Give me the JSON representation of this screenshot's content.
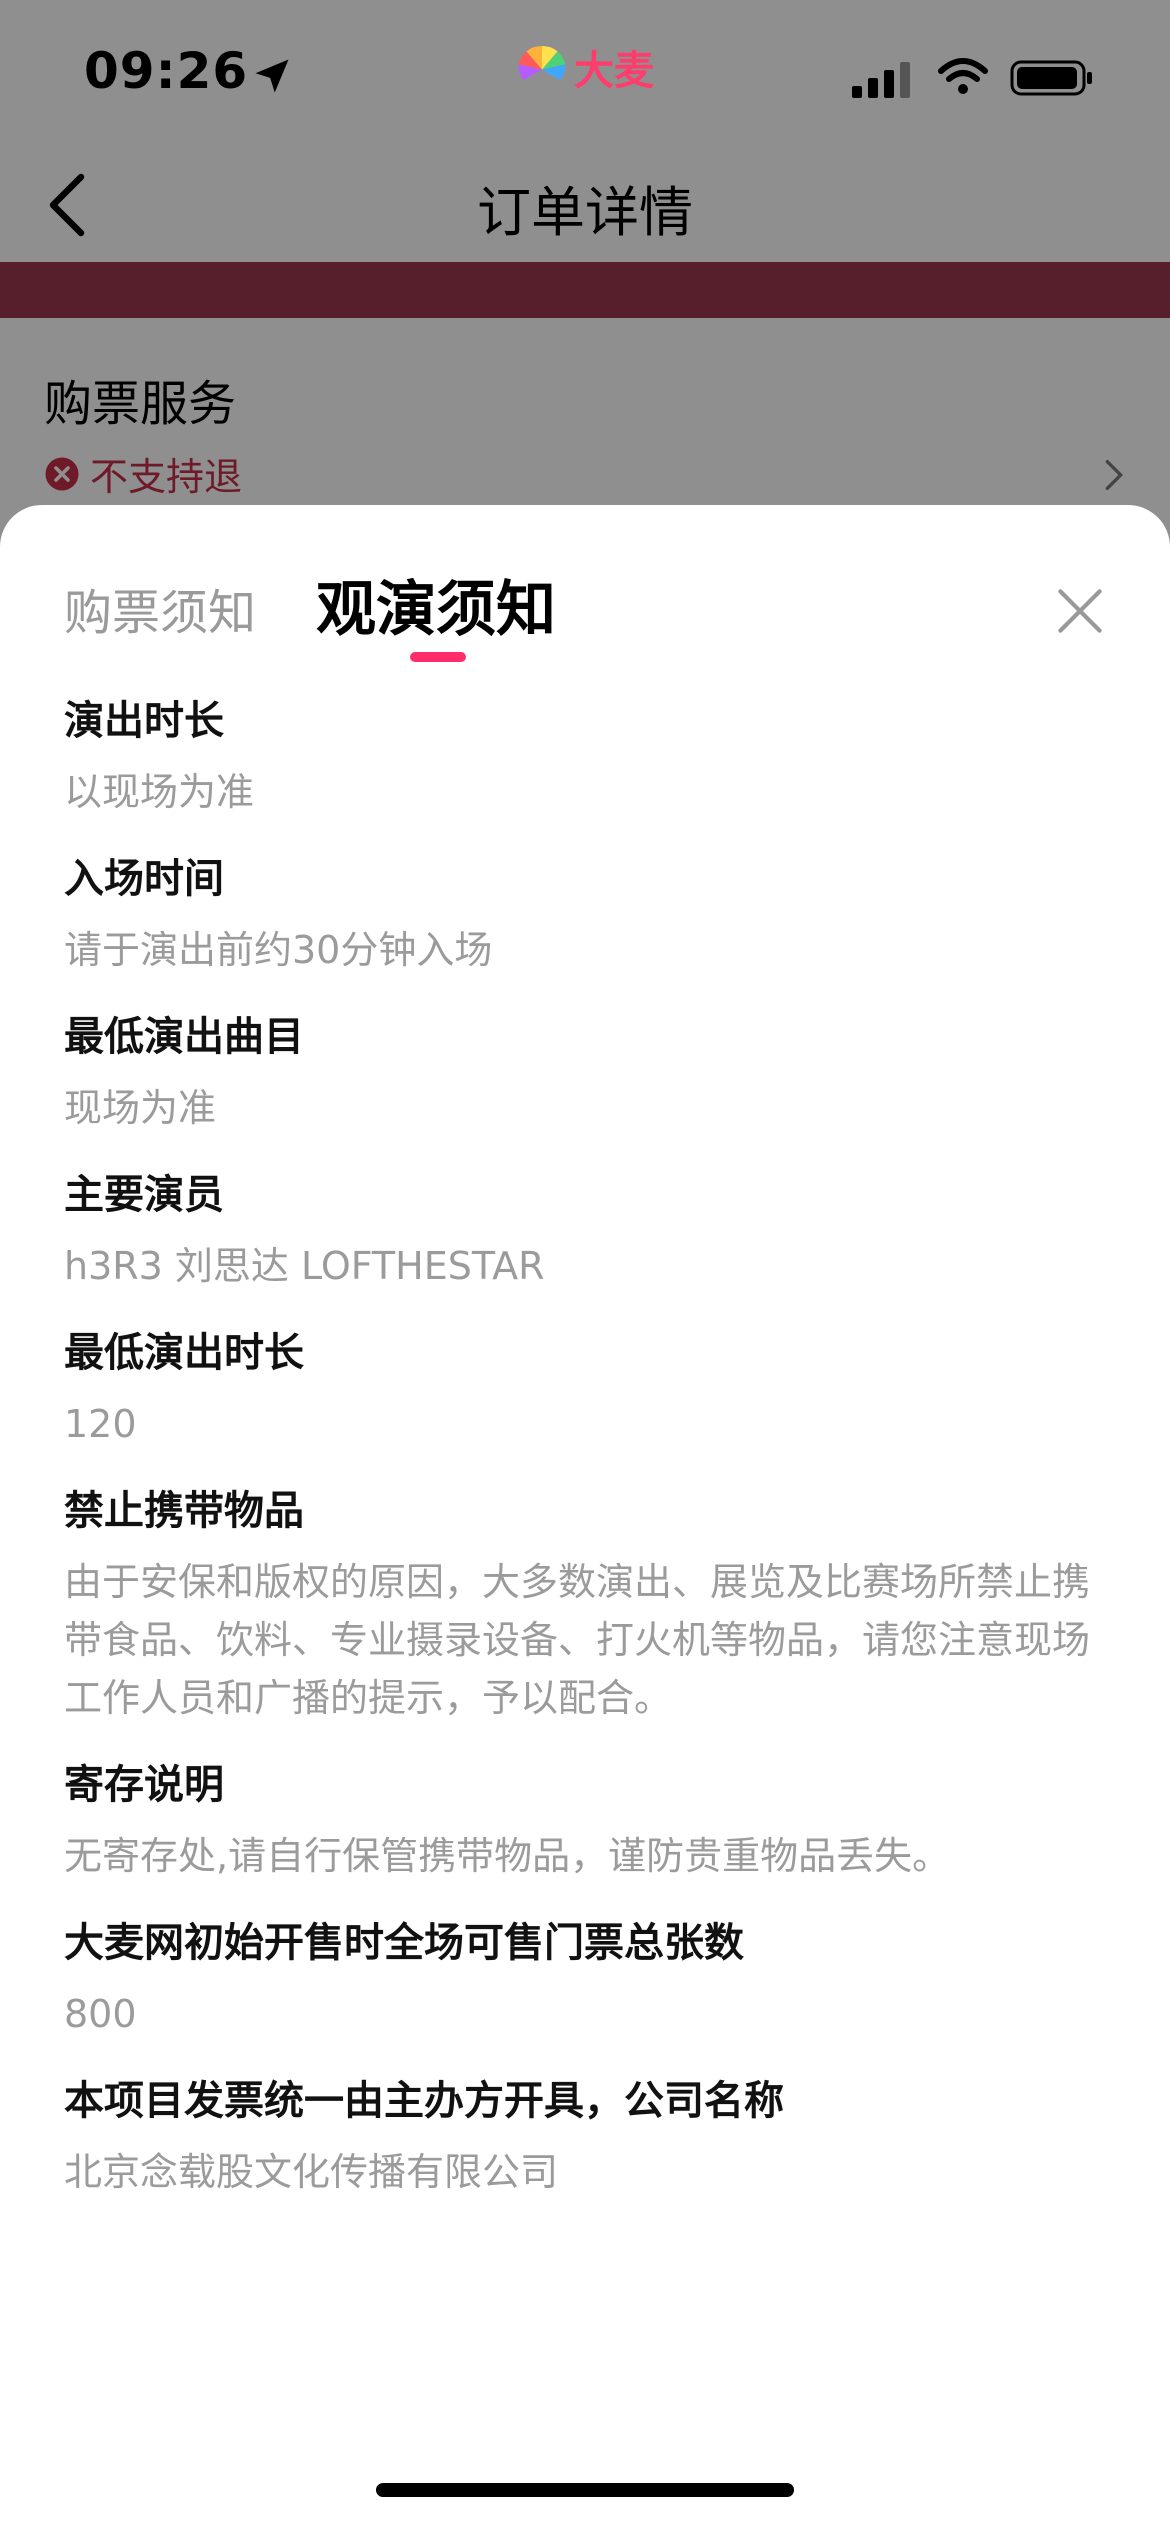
{
  "status_bar": {
    "time": "09:26",
    "brand_name": "大麦"
  },
  "nav": {
    "title": "订单详情"
  },
  "background_section": {
    "title": "购票服务",
    "status": "不支持退"
  },
  "sheet": {
    "tabs": [
      {
        "label": "购票须知",
        "active": false
      },
      {
        "label": "观演须知",
        "active": true
      }
    ],
    "items": [
      {
        "label": "演出时长",
        "value": "以现场为准"
      },
      {
        "label": "入场时间",
        "value": "请于演出前约30分钟入场"
      },
      {
        "label": "最低演出曲目",
        "value": "现场为准"
      },
      {
        "label": "主要演员",
        "value": "h3R3 刘思达 LOFTHESTAR"
      },
      {
        "label": "最低演出时长",
        "value": "120"
      },
      {
        "label": "禁止携带物品",
        "value": "由于安保和版权的原因，大多数演出、展览及比赛场所禁止携带食品、饮料、专业摄录设备、打火机等物品，请您注意现场工作人员和广播的提示，予以配合。"
      },
      {
        "label": "寄存说明",
        "value": "无寄存处,请自行保管携带物品，谨防贵重物品丢失。"
      },
      {
        "label": "大麦网初始开售时全场可售门票总张数",
        "value": "800"
      },
      {
        "label": "本项目发票统一由主办方开具，公司名称",
        "value": "北京念载股文化传播有限公司"
      }
    ]
  },
  "colors": {
    "accent": "#ff2d6a",
    "overlay_background": "#8f8f8f",
    "banner": "#561f2b",
    "muted_text": "#9b9b9b"
  },
  "icons": [
    "location-arrow-icon",
    "brand-logo-icon",
    "signal-icon",
    "wifi-icon",
    "battery-icon",
    "chevron-left-icon",
    "x-circle-icon",
    "chevron-right-icon",
    "close-icon"
  ]
}
